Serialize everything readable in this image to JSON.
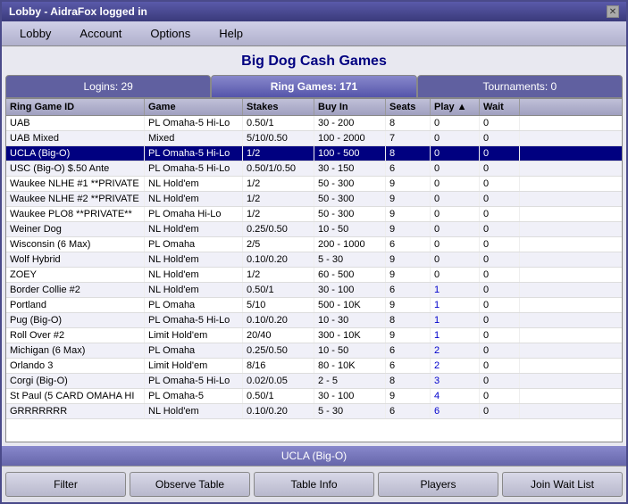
{
  "window": {
    "title": "Lobby - AidraFox logged in"
  },
  "menu": {
    "items": [
      "Lobby",
      "Account",
      "Options",
      "Help"
    ]
  },
  "page": {
    "title": "Big Dog Cash Games"
  },
  "tabs": [
    {
      "label": "Logins: 29",
      "active": false
    },
    {
      "label": "Ring Games: 171",
      "active": true
    },
    {
      "label": "Tournaments: 0",
      "active": false
    }
  ],
  "table": {
    "headers": [
      "Ring Game ID",
      "Game",
      "Stakes",
      "Buy In",
      "Seats",
      "Play ▲",
      "Wait"
    ],
    "rows": [
      {
        "id": "UAB",
        "game": "PL Omaha-5 Hi-Lo",
        "stakes": "0.50/1",
        "buyin": "30 - 200",
        "seats": "8",
        "play": "0",
        "wait": "0",
        "selected": false
      },
      {
        "id": "UAB Mixed",
        "game": "Mixed",
        "stakes": "5/10/0.50",
        "buyin": "100 - 2000",
        "seats": "7",
        "play": "0",
        "wait": "0",
        "selected": false
      },
      {
        "id": "UCLA (Big-O)",
        "game": "PL Omaha-5 Hi-Lo",
        "stakes": "1/2",
        "buyin": "100 - 500",
        "seats": "8",
        "play": "0",
        "wait": "0",
        "selected": true
      },
      {
        "id": "USC (Big-O) $.50 Ante",
        "game": "PL Omaha-5 Hi-Lo",
        "stakes": "0.50/1/0.50",
        "buyin": "30 - 150",
        "seats": "6",
        "play": "0",
        "wait": "0",
        "selected": false
      },
      {
        "id": "Waukee NLHE #1 **PRIVATE",
        "game": "NL Hold'em",
        "stakes": "1/2",
        "buyin": "50 - 300",
        "seats": "9",
        "play": "0",
        "wait": "0",
        "selected": false
      },
      {
        "id": "Waukee NLHE #2 **PRIVATE",
        "game": "NL Hold'em",
        "stakes": "1/2",
        "buyin": "50 - 300",
        "seats": "9",
        "play": "0",
        "wait": "0",
        "selected": false
      },
      {
        "id": "Waukee PLO8 **PRIVATE**",
        "game": "PL Omaha Hi-Lo",
        "stakes": "1/2",
        "buyin": "50 - 300",
        "seats": "9",
        "play": "0",
        "wait": "0",
        "selected": false
      },
      {
        "id": "Weiner Dog",
        "game": "NL Hold'em",
        "stakes": "0.25/0.50",
        "buyin": "10 - 50",
        "seats": "9",
        "play": "0",
        "wait": "0",
        "selected": false
      },
      {
        "id": "Wisconsin (6 Max)",
        "game": "PL Omaha",
        "stakes": "2/5",
        "buyin": "200 - 1000",
        "seats": "6",
        "play": "0",
        "wait": "0",
        "selected": false
      },
      {
        "id": "Wolf Hybrid",
        "game": "NL Hold'em",
        "stakes": "0.10/0.20",
        "buyin": "5 - 30",
        "seats": "9",
        "play": "0",
        "wait": "0",
        "selected": false
      },
      {
        "id": "ZOEY",
        "game": "NL Hold'em",
        "stakes": "1/2",
        "buyin": "60 - 500",
        "seats": "9",
        "play": "0",
        "wait": "0",
        "selected": false
      },
      {
        "id": "Border Collie #2",
        "game": "NL Hold'em",
        "stakes": "0.50/1",
        "buyin": "30 - 100",
        "seats": "6",
        "play": "1",
        "wait": "0",
        "selected": false
      },
      {
        "id": "Portland",
        "game": "PL Omaha",
        "stakes": "5/10",
        "buyin": "500 - 10K",
        "seats": "9",
        "play": "1",
        "wait": "0",
        "selected": false
      },
      {
        "id": "Pug (Big-O)",
        "game": "PL Omaha-5 Hi-Lo",
        "stakes": "0.10/0.20",
        "buyin": "10 - 30",
        "seats": "8",
        "play": "1",
        "wait": "0",
        "selected": false
      },
      {
        "id": "Roll Over #2",
        "game": "Limit Hold'em",
        "stakes": "20/40",
        "buyin": "300 - 10K",
        "seats": "9",
        "play": "1",
        "wait": "0",
        "selected": false
      },
      {
        "id": "Michigan (6 Max)",
        "game": "PL Omaha",
        "stakes": "0.25/0.50",
        "buyin": "10 - 50",
        "seats": "6",
        "play": "2",
        "wait": "0",
        "selected": false
      },
      {
        "id": "Orlando 3",
        "game": "Limit Hold'em",
        "stakes": "8/16",
        "buyin": "80 - 10K",
        "seats": "6",
        "play": "2",
        "wait": "0",
        "selected": false
      },
      {
        "id": "Corgi (Big-O)",
        "game": "PL Omaha-5 Hi-Lo",
        "stakes": "0.02/0.05",
        "buyin": "2 - 5",
        "seats": "8",
        "play": "3",
        "wait": "0",
        "selected": false
      },
      {
        "id": "St Paul (5 CARD OMAHA HI",
        "game": "PL Omaha-5",
        "stakes": "0.50/1",
        "buyin": "30 - 100",
        "seats": "9",
        "play": "4",
        "wait": "0",
        "selected": false
      },
      {
        "id": "GRRRRRRR",
        "game": "NL Hold'em",
        "stakes": "0.10/0.20",
        "buyin": "5 - 30",
        "seats": "6",
        "play": "6",
        "wait": "0",
        "selected": false
      }
    ]
  },
  "status": {
    "text": "UCLA (Big-O)"
  },
  "buttons": [
    {
      "label": "Filter",
      "name": "filter-button"
    },
    {
      "label": "Observe Table",
      "name": "observe-table-button"
    },
    {
      "label": "Table Info",
      "name": "table-info-button"
    },
    {
      "label": "Players",
      "name": "players-button"
    },
    {
      "label": "Join Wait List",
      "name": "join-wait-list-button"
    }
  ]
}
